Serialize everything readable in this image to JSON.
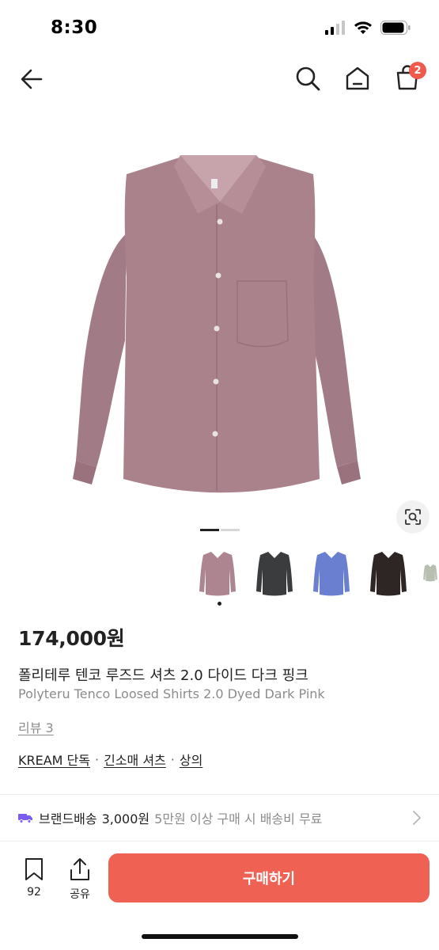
{
  "status_bar": {
    "time": "8:30"
  },
  "nav": {
    "cart_count": "2"
  },
  "product": {
    "price": "174,000원",
    "name_ko": "폴리테루 텐코 루즈드 셔츠 2.0 다이드 다크 핑크",
    "name_en": "Polyteru Tenco Loosed Shirts 2.0 Dyed Dark Pink",
    "review_link": "리뷰 3",
    "tags": [
      "KREAM 단독",
      "긴소매 셔츠",
      "상의"
    ],
    "main_color": "#a9828c",
    "thumbnails": [
      {
        "color": "#ad8590"
      },
      {
        "color": "#3a3c3e"
      },
      {
        "color": "#6b7fd0"
      },
      {
        "color": "#2e2624"
      },
      {
        "color": "#b9bfb0"
      }
    ]
  },
  "delivery": {
    "label": "브랜드배송",
    "price": "3,000원",
    "note": "5만원 이상 구매 시 배송비 무료",
    "icon": "truck-icon"
  },
  "bottom_bar": {
    "bookmark_count": "92",
    "share_label": "공유",
    "buy_label": "구매하기",
    "buy_color": "#ef6253"
  }
}
